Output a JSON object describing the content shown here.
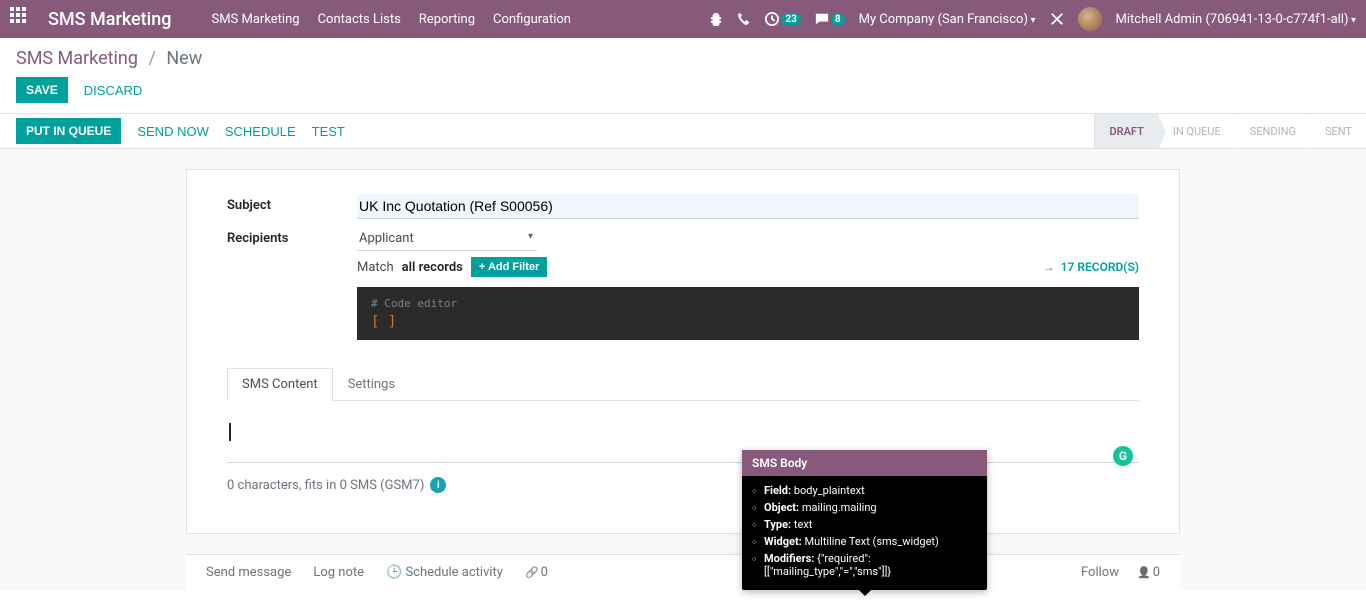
{
  "topnav": {
    "brand": "SMS Marketing",
    "menu": [
      "SMS Marketing",
      "Contacts Lists",
      "Reporting",
      "Configuration"
    ],
    "clock_badge": "23",
    "chat_badge": "8",
    "company": "My Company (San Francisco)",
    "user": "Mitchell Admin (706941-13-0-c774f1-all)"
  },
  "breadcrumb": {
    "root": "SMS Marketing",
    "current": "New"
  },
  "ctrl": {
    "save": "Save",
    "discard": "Discard"
  },
  "statusbar": {
    "buttons": {
      "put_in_queue": "Put in Queue",
      "send_now": "Send Now",
      "schedule": "Schedule",
      "test": "Test"
    },
    "steps": [
      "Draft",
      "In Queue",
      "Sending",
      "Sent"
    ],
    "active_step": "Draft"
  },
  "form": {
    "subject_label": "Subject",
    "subject_value": "UK Inc Quotation (Ref S00056)",
    "recipients_label": "Recipients",
    "recipients_value": "Applicant",
    "match_prefix": "Match",
    "match_bold": "all records",
    "add_filter": "Add Filter",
    "records_count": "17 RECORD(S)",
    "code_editor_comment": "# Code editor",
    "code_editor_body": "[ ]",
    "tabs": [
      "SMS Content",
      "Settings"
    ],
    "active_tab": "SMS Content",
    "counter": "0 characters, fits in 0 SMS (GSM7)"
  },
  "tooltip": {
    "title": "SMS Body",
    "rows": [
      {
        "k": "Field:",
        "v": "body_plaintext"
      },
      {
        "k": "Object:",
        "v": "mailing.mailing"
      },
      {
        "k": "Type:",
        "v": "text"
      },
      {
        "k": "Widget:",
        "v": "Multiline Text (sms_widget)"
      },
      {
        "k": "Modifiers:",
        "v": "{\"required\":[[\"mailing_type\",\"=\",\"sms\"]]}"
      }
    ]
  },
  "chatter": {
    "send_message": "Send message",
    "log_note": "Log note",
    "schedule_activity": "Schedule activity",
    "attach_count": "0",
    "follow": "Follow",
    "follower_count": "0"
  }
}
